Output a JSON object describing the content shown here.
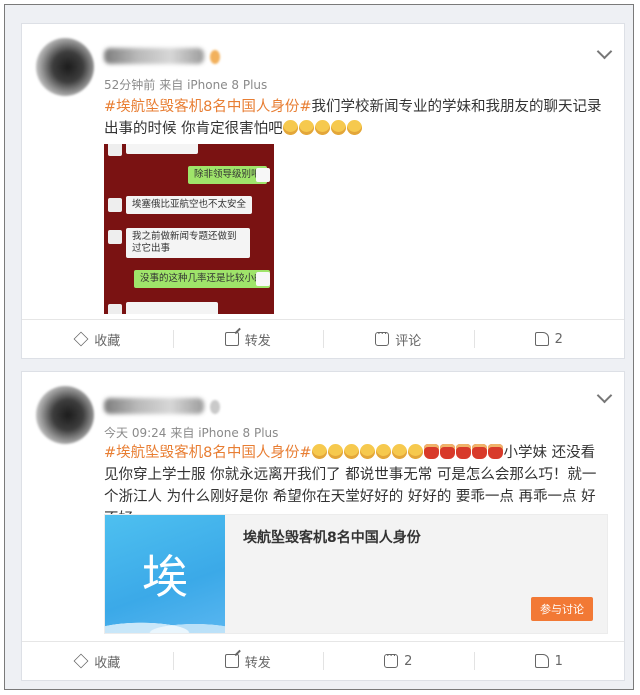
{
  "posts": [
    {
      "meta_time": "52分钟前",
      "meta_source": "来自 iPhone 8 Plus",
      "hashtag": "#埃航坠毁客机8名中国人身份#",
      "body": "我们学校新闻专业的学妹和我朋友的聊天记录 出事的时候 你肯定很害怕吧",
      "emoji_count": 5,
      "chat": {
        "messages": [
          {
            "side": "right",
            "text": "除非领导级别吧"
          },
          {
            "side": "left",
            "text": "埃塞俄比亚航空也不太安全"
          },
          {
            "side": "left",
            "text": "我之前做新闻专题还做到过它出事"
          },
          {
            "side": "right",
            "text": "没事的这种几率还是比较小的"
          }
        ]
      },
      "actions": {
        "favorite": "收藏",
        "repost": "转发",
        "comment": "评论",
        "like": "2"
      }
    },
    {
      "meta_time": "今天 09:24",
      "meta_source": "来自 iPhone 8 Plus",
      "hashtag": "#埃航坠毁客机8名中国人身份#",
      "body": "小学妹 还没看见你穿上学士服 你就永远离开我们了 都说世事无常 可是怎么会那么巧！就一个浙江人 为什么刚好是你 希望你在天堂好好的 好好的 要乖一点 再乖一点 好不好",
      "emoji_count": 7,
      "gift_count": 5,
      "topic": {
        "thumb_char": "埃",
        "title": "埃航坠毁客机8名中国人身份",
        "button": "参与讨论"
      },
      "actions": {
        "favorite": "收藏",
        "repost": "转发",
        "comment": "2",
        "like": "1"
      }
    }
  ],
  "colors": {
    "hashtag": "#e87e33",
    "chat_bg": "#7a1212",
    "topic_button": "#f27935",
    "topic_thumb": "#3ba9e8"
  },
  "icons": [
    "chevron-down-icon",
    "star-icon",
    "repost-icon",
    "comment-icon",
    "like-icon"
  ]
}
